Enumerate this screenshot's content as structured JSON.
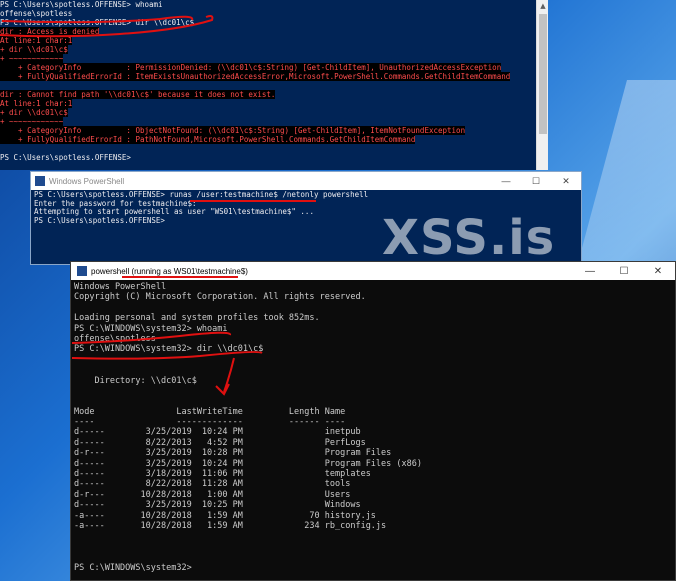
{
  "window1": {
    "lines": [
      {
        "text": "PS C:\\Users\\spotless.OFFENSE> whoami",
        "err": false
      },
      {
        "text": "offense\\spotless",
        "err": false
      },
      {
        "text": "PS C:\\Users\\spotless.OFFENSE> dir \\\\dc01\\c$",
        "err": false
      },
      {
        "text": "dir : Access is denied",
        "err": true
      },
      {
        "text": "At line:1 char:1",
        "err": true
      },
      {
        "text": "+ dir \\\\dc01\\c$",
        "err": true
      },
      {
        "text": "+ ~~~~~~~~~~~~",
        "err": true
      },
      {
        "text": "    + CategoryInfo          : PermissionDenied: (\\\\dc01\\c$:String) [Get-ChildItem], UnauthorizedAccessException",
        "err": true
      },
      {
        "text": "    + FullyQualifiedErrorId : ItemExistsUnauthorizedAccessError,Microsoft.PowerShell.Commands.GetChildItemCommand",
        "err": true
      },
      {
        "text": "",
        "err": false
      },
      {
        "text": "dir : Cannot find path '\\\\dc01\\c$' because it does not exist.",
        "err": true
      },
      {
        "text": "At line:1 char:1",
        "err": true
      },
      {
        "text": "+ dir \\\\dc01\\c$",
        "err": true
      },
      {
        "text": "+ ~~~~~~~~~~~~",
        "err": true
      },
      {
        "text": "    + CategoryInfo          : ObjectNotFound: (\\\\dc01\\c$:String) [Get-ChildItem], ItemNotFoundException",
        "err": true
      },
      {
        "text": "    + FullyQualifiedErrorId : PathNotFound,Microsoft.PowerShell.Commands.GetChildItemCommand",
        "err": true
      },
      {
        "text": "",
        "err": false
      },
      {
        "text": "PS C:\\Users\\spotless.OFFENSE>",
        "err": false
      }
    ]
  },
  "window2": {
    "title": "Windows PowerShell",
    "lines": [
      "PS C:\\Users\\spotless.OFFENSE> runas /user:testmachine$ /netonly powershell",
      "Enter the password for testmachine$:",
      "Attempting to start powershell as user \"WS01\\testmachine$\" ...",
      "PS C:\\Users\\spotless.OFFENSE>"
    ]
  },
  "watermark": "XSS.is",
  "window3": {
    "title": "powershell (running as WS01\\testmachine$)",
    "lines": [
      "Windows PowerShell",
      "Copyright (C) Microsoft Corporation. All rights reserved.",
      "",
      "Loading personal and system profiles took 852ms.",
      "PS C:\\WINDOWS\\system32> whoami",
      "offense\\spotless",
      "PS C:\\WINDOWS\\system32> dir \\\\dc01\\c$",
      "",
      "",
      "    Directory: \\\\dc01\\c$",
      "",
      "",
      "Mode                LastWriteTime         Length Name",
      "----                -------------         ------ ----",
      "d-----        3/25/2019  10:24 PM                inetpub",
      "d-----        8/22/2013   4:52 PM                PerfLogs",
      "d-r---        3/25/2019  10:28 PM                Program Files",
      "d-----        3/25/2019  10:24 PM                Program Files (x86)",
      "d-----        3/18/2019  11:06 PM                templates",
      "d-----        8/22/2018  11:28 AM                tools",
      "d-r---       10/28/2018   1:00 AM                Users",
      "d-----        3/25/2019  10:25 PM                Windows",
      "-a----       10/28/2018   1:59 AM             70 history.js",
      "-a----       10/28/2018   1:59 AM            234 rb_config.js",
      "",
      "",
      "",
      "PS C:\\WINDOWS\\system32>"
    ]
  },
  "controls": {
    "minimize": "—",
    "maximize": "☐",
    "close": "✕"
  },
  "colors": {
    "ps_blue": "#012456",
    "console_black": "#0c0c0c",
    "error_red": "#ff4d4d",
    "annotation_red": "#e01010"
  }
}
